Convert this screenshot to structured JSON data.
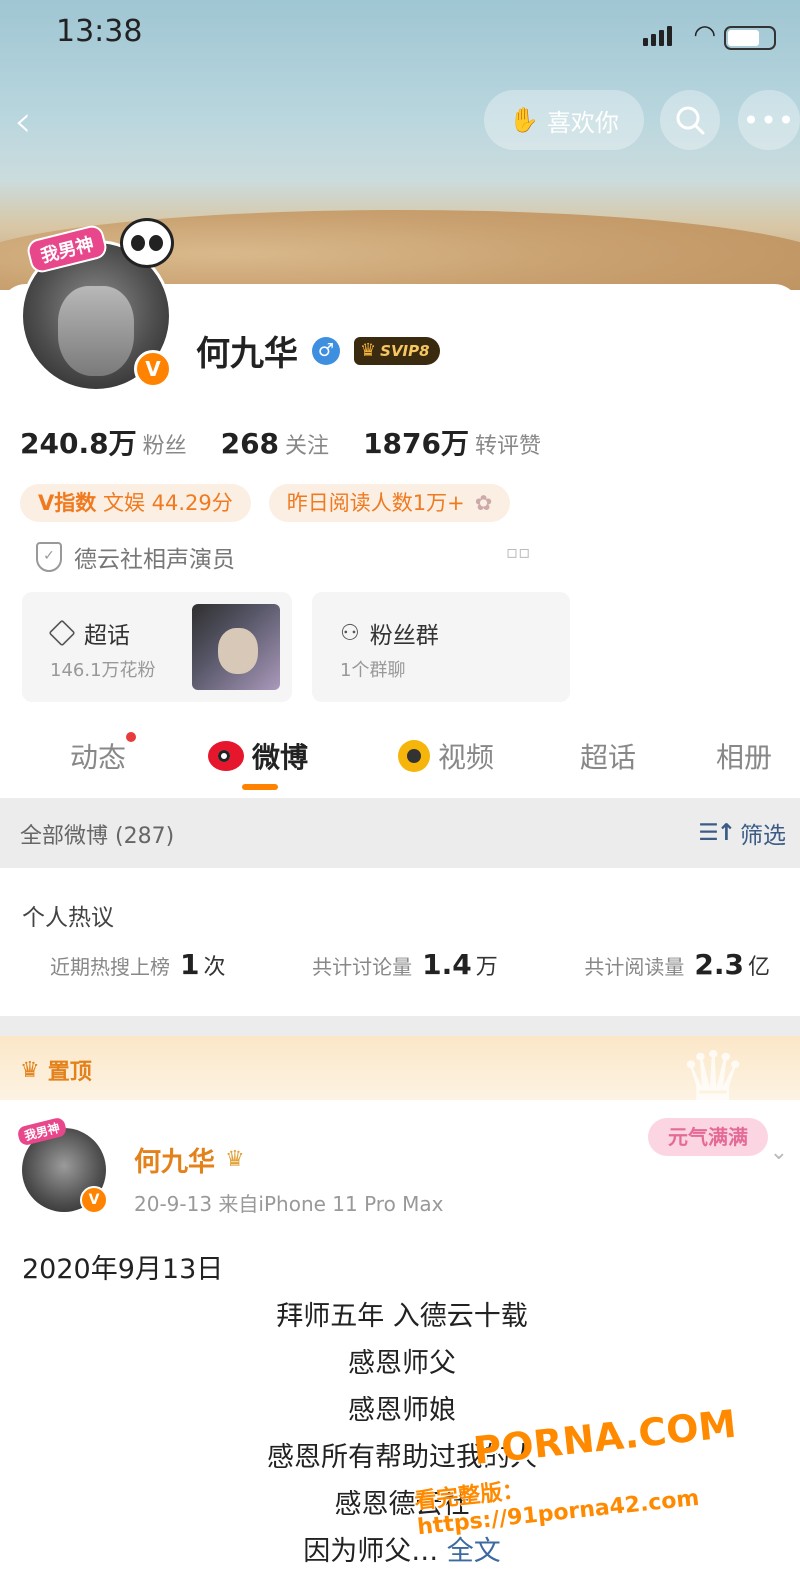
{
  "status_bar": {
    "time": "13:38"
  },
  "header": {
    "like_label": "喜欢你"
  },
  "profile": {
    "avatar_sticker": "我男神",
    "name": "何九华",
    "gender_symbol": "♂",
    "svip_label": "SVIP8",
    "stats": [
      {
        "value": "240.8万",
        "label": "粉丝"
      },
      {
        "value": "268",
        "label": "关注"
      },
      {
        "value": "1876万",
        "label": "转评赞"
      }
    ],
    "tags": [
      {
        "prefix": "V指数",
        "text": "文娱 44.29分"
      },
      {
        "prefix": "",
        "text": "昨日阅读人数1万+"
      }
    ],
    "certification": "德云社相声演员"
  },
  "features": {
    "chaohua": {
      "title": "超话",
      "sub": "146.1万花粉"
    },
    "fans": {
      "title": "粉丝群",
      "sub": "1个群聊"
    }
  },
  "tabs": [
    "动态",
    "微博",
    "视频",
    "超话",
    "相册"
  ],
  "filter": {
    "all": "全部微博 (287)",
    "sift": "筛选"
  },
  "hot": {
    "title": "个人热议",
    "metrics": [
      {
        "label": "近期热搜上榜",
        "value": "1",
        "unit": "次"
      },
      {
        "label": "共计讨论量",
        "value": "1.4",
        "unit": "万"
      },
      {
        "label": "共计阅读量",
        "value": "2.3",
        "unit": "亿"
      }
    ]
  },
  "pinned": {
    "label": "置顶"
  },
  "post": {
    "avatar_sticker": "我男神",
    "author": "何九华",
    "meta": "20-9-13  来自iPhone 11 Pro Max",
    "sticker": "元气满满",
    "lines": [
      "2020年9月13日",
      "拜师五年   入德云十载",
      "感恩师父",
      "感恩师娘",
      "感恩所有帮助过我的人",
      "感恩德云社",
      "因为师父…"
    ],
    "more": "全文"
  },
  "watermark": {
    "site": "PORNA.COM",
    "text": "看完整版：https://91porna42.com"
  }
}
